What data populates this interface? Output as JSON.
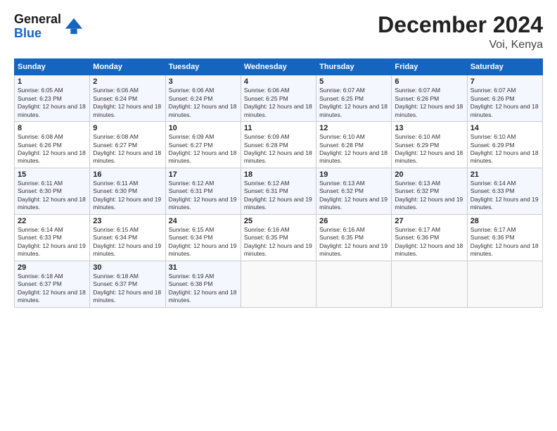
{
  "logo": {
    "line1": "General",
    "line2": "Blue"
  },
  "header": {
    "title": "December 2024",
    "location": "Voi, Kenya"
  },
  "days_of_week": [
    "Sunday",
    "Monday",
    "Tuesday",
    "Wednesday",
    "Thursday",
    "Friday",
    "Saturday"
  ],
  "weeks": [
    [
      {
        "day": "1",
        "sunrise": "6:05 AM",
        "sunset": "6:23 PM",
        "daylight": "12 hours and 18 minutes."
      },
      {
        "day": "2",
        "sunrise": "6:06 AM",
        "sunset": "6:24 PM",
        "daylight": "12 hours and 18 minutes."
      },
      {
        "day": "3",
        "sunrise": "6:06 AM",
        "sunset": "6:24 PM",
        "daylight": "12 hours and 18 minutes."
      },
      {
        "day": "4",
        "sunrise": "6:06 AM",
        "sunset": "6:25 PM",
        "daylight": "12 hours and 18 minutes."
      },
      {
        "day": "5",
        "sunrise": "6:07 AM",
        "sunset": "6:25 PM",
        "daylight": "12 hours and 18 minutes."
      },
      {
        "day": "6",
        "sunrise": "6:07 AM",
        "sunset": "6:26 PM",
        "daylight": "12 hours and 18 minutes."
      },
      {
        "day": "7",
        "sunrise": "6:07 AM",
        "sunset": "6:26 PM",
        "daylight": "12 hours and 18 minutes."
      }
    ],
    [
      {
        "day": "8",
        "sunrise": "6:08 AM",
        "sunset": "6:26 PM",
        "daylight": "12 hours and 18 minutes."
      },
      {
        "day": "9",
        "sunrise": "6:08 AM",
        "sunset": "6:27 PM",
        "daylight": "12 hours and 18 minutes."
      },
      {
        "day": "10",
        "sunrise": "6:09 AM",
        "sunset": "6:27 PM",
        "daylight": "12 hours and 18 minutes."
      },
      {
        "day": "11",
        "sunrise": "6:09 AM",
        "sunset": "6:28 PM",
        "daylight": "12 hours and 18 minutes."
      },
      {
        "day": "12",
        "sunrise": "6:10 AM",
        "sunset": "6:28 PM",
        "daylight": "12 hours and 18 minutes."
      },
      {
        "day": "13",
        "sunrise": "6:10 AM",
        "sunset": "6:29 PM",
        "daylight": "12 hours and 18 minutes."
      },
      {
        "day": "14",
        "sunrise": "6:10 AM",
        "sunset": "6:29 PM",
        "daylight": "12 hours and 18 minutes."
      }
    ],
    [
      {
        "day": "15",
        "sunrise": "6:11 AM",
        "sunset": "6:30 PM",
        "daylight": "12 hours and 18 minutes."
      },
      {
        "day": "16",
        "sunrise": "6:11 AM",
        "sunset": "6:30 PM",
        "daylight": "12 hours and 19 minutes."
      },
      {
        "day": "17",
        "sunrise": "6:12 AM",
        "sunset": "6:31 PM",
        "daylight": "12 hours and 19 minutes."
      },
      {
        "day": "18",
        "sunrise": "6:12 AM",
        "sunset": "6:31 PM",
        "daylight": "12 hours and 19 minutes."
      },
      {
        "day": "19",
        "sunrise": "6:13 AM",
        "sunset": "6:32 PM",
        "daylight": "12 hours and 19 minutes."
      },
      {
        "day": "20",
        "sunrise": "6:13 AM",
        "sunset": "6:32 PM",
        "daylight": "12 hours and 19 minutes."
      },
      {
        "day": "21",
        "sunrise": "6:14 AM",
        "sunset": "6:33 PM",
        "daylight": "12 hours and 19 minutes."
      }
    ],
    [
      {
        "day": "22",
        "sunrise": "6:14 AM",
        "sunset": "6:33 PM",
        "daylight": "12 hours and 19 minutes."
      },
      {
        "day": "23",
        "sunrise": "6:15 AM",
        "sunset": "6:34 PM",
        "daylight": "12 hours and 19 minutes."
      },
      {
        "day": "24",
        "sunrise": "6:15 AM",
        "sunset": "6:34 PM",
        "daylight": "12 hours and 19 minutes."
      },
      {
        "day": "25",
        "sunrise": "6:16 AM",
        "sunset": "6:35 PM",
        "daylight": "12 hours and 19 minutes."
      },
      {
        "day": "26",
        "sunrise": "6:16 AM",
        "sunset": "6:35 PM",
        "daylight": "12 hours and 19 minutes."
      },
      {
        "day": "27",
        "sunrise": "6:17 AM",
        "sunset": "6:36 PM",
        "daylight": "12 hours and 18 minutes."
      },
      {
        "day": "28",
        "sunrise": "6:17 AM",
        "sunset": "6:36 PM",
        "daylight": "12 hours and 18 minutes."
      }
    ],
    [
      {
        "day": "29",
        "sunrise": "6:18 AM",
        "sunset": "6:37 PM",
        "daylight": "12 hours and 18 minutes."
      },
      {
        "day": "30",
        "sunrise": "6:18 AM",
        "sunset": "6:37 PM",
        "daylight": "12 hours and 18 minutes."
      },
      {
        "day": "31",
        "sunrise": "6:19 AM",
        "sunset": "6:38 PM",
        "daylight": "12 hours and 18 minutes."
      },
      null,
      null,
      null,
      null
    ]
  ]
}
